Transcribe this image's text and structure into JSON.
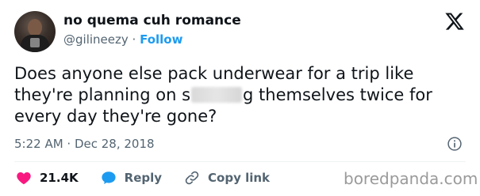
{
  "author": {
    "display_name": "no quema cuh romance",
    "handle": "@gilineezy",
    "separator": " · ",
    "follow_label": "Follow"
  },
  "tweet": {
    "text_before": "Does anyone else pack underwear for a trip like they're planning on s",
    "text_after": "g themselves twice for every day they're gone?"
  },
  "meta": {
    "timestamp": "5:22 AM · Dec 28, 2018"
  },
  "actions": {
    "likes": "21.4K",
    "reply_label": "Reply",
    "copy_link_label": "Copy link"
  },
  "watermark": "boredpanda.com",
  "colors": {
    "link": "#1d9bf0",
    "heart": "#f91880",
    "muted": "#536471"
  }
}
